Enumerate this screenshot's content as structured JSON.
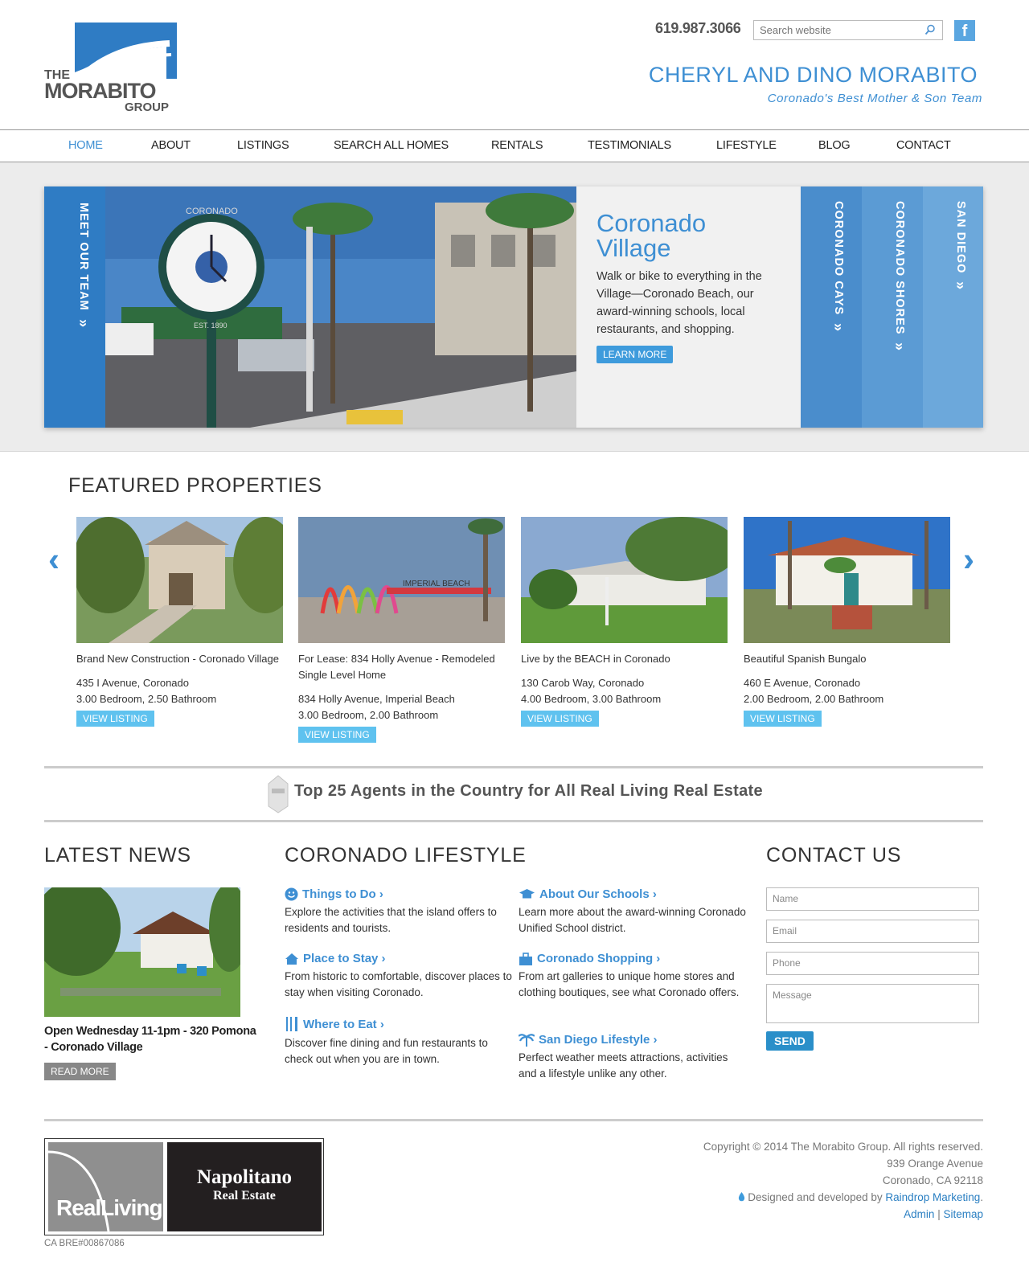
{
  "header": {
    "logo_top": "THE",
    "logo_main": "MORABITO",
    "logo_sub": "GROUP",
    "phone": "619.987.3066",
    "search_placeholder": "Search website",
    "facebook_label": "f",
    "names": "CHERYL AND DINO MORABITO",
    "tagline": "Coronado's Best Mother & Son Team"
  },
  "nav": [
    {
      "label": "HOME",
      "active": true
    },
    {
      "label": "ABOUT"
    },
    {
      "label": "LISTINGS"
    },
    {
      "label": "SEARCH ALL HOMES"
    },
    {
      "label": "RENTALS"
    },
    {
      "label": "TESTIMONIALS"
    },
    {
      "label": "LIFESTYLE"
    },
    {
      "label": "BLOG"
    },
    {
      "label": "CONTACT"
    }
  ],
  "hero": {
    "left_tab": "MEET OUR TEAM",
    "photo_clock_text": "CORONADO",
    "photo_clock_est": "EST. 1890",
    "title_line1": "Coronado",
    "title_line2": "Village",
    "description": "Walk or bike to everything in the Village—Coronado Beach, our award-winning schools, local restaurants, and shopping.",
    "button": "LEARN MORE",
    "right_tabs": [
      "CORONADO CAYS",
      "CORONADO SHORES",
      "SAN DIEGO"
    ],
    "tab_chevron": "»"
  },
  "featured": {
    "title": "FEATURED PROPERTIES",
    "prev": "‹",
    "next": "›",
    "listings": [
      {
        "title": "Brand New Construction - Coronado Village",
        "address": "435 I Avenue, Coronado",
        "rooms": "3.00 Bedroom, 2.50 Bathroom",
        "button": "VIEW LISTING"
      },
      {
        "title": "For Lease: 834 Holly Avenue - Remodeled Single Level Home",
        "address": "834 Holly Avenue, Imperial Beach",
        "rooms": "3.00 Bedroom, 2.00 Bathroom",
        "button": "VIEW LISTING",
        "sign": "IMPERIAL BEACH"
      },
      {
        "title": "Live by the BEACH in Coronado",
        "address": "130 Carob Way, Coronado",
        "rooms": "4.00 Bedroom, 3.00 Bathroom",
        "button": "VIEW LISTING"
      },
      {
        "title": "Beautiful Spanish Bungalo",
        "address": "460 E Avenue, Coronado",
        "rooms": "2.00 Bedroom, 2.00 Bathroom",
        "button": "VIEW LISTING"
      }
    ]
  },
  "agents_banner": "Top 25 Agents in the Country for All Real Living Real Estate",
  "news": {
    "title": "LATEST NEWS",
    "caption": "Open Wednesday 11-1pm - 320 Pomona - Coronado Village",
    "button": "READ MORE"
  },
  "lifestyle": {
    "title": "CORONADO LIFESTYLE",
    "items": [
      {
        "title": "Things to Do ›",
        "desc": "Explore the activities that the island offers to residents and tourists.",
        "icon": "smile-icon"
      },
      {
        "title": "Place to Stay ›",
        "desc": "From historic to comfortable, discover places to stay when visiting Coronado.",
        "icon": "home-icon"
      },
      {
        "title": "Where to Eat ›",
        "desc": "Discover fine dining and fun restaurants to check out when you are in town.",
        "icon": "utensils-icon"
      },
      {
        "title": "About Our Schools ›",
        "desc": "Learn more about the award-winning Coronado Unified School district.",
        "icon": "graduation-cap-icon"
      },
      {
        "title": "Coronado Shopping ›",
        "desc": "From art galleries to unique home stores and clothing boutiques, see what Coronado offers.",
        "icon": "shopping-bag-icon"
      },
      {
        "title": "San Diego Lifestyle ›",
        "desc": "Perfect weather meets attractions, activities and a lifestyle unlike any other.",
        "icon": "palm-tree-icon"
      }
    ]
  },
  "contact": {
    "title": "CONTACT US",
    "name_placeholder": "Name",
    "email_placeholder": "Email",
    "phone_placeholder": "Phone",
    "message_placeholder": "Message",
    "button": "SEND"
  },
  "footer": {
    "reallife_logo": "RealLiving",
    "napolitano_line1": "Napolitano",
    "napolitano_line2": "Real Estate",
    "license": "CA BRE#00867086",
    "copyright": "Copyright © 2014 The Morabito Group. All rights reserved.",
    "address1": "939 Orange Avenue",
    "address2": "Coronado, CA 92118",
    "designed_by": "Designed and developed by",
    "designer": "Raindrop Marketing",
    "period": ".",
    "admin": "Admin",
    "separator": "|",
    "sitemap": "Sitemap"
  },
  "colors": {
    "brand_blue": "#3e8fd3",
    "button_blue": "#3e9bdc",
    "light_button": "#5fc2ef"
  }
}
